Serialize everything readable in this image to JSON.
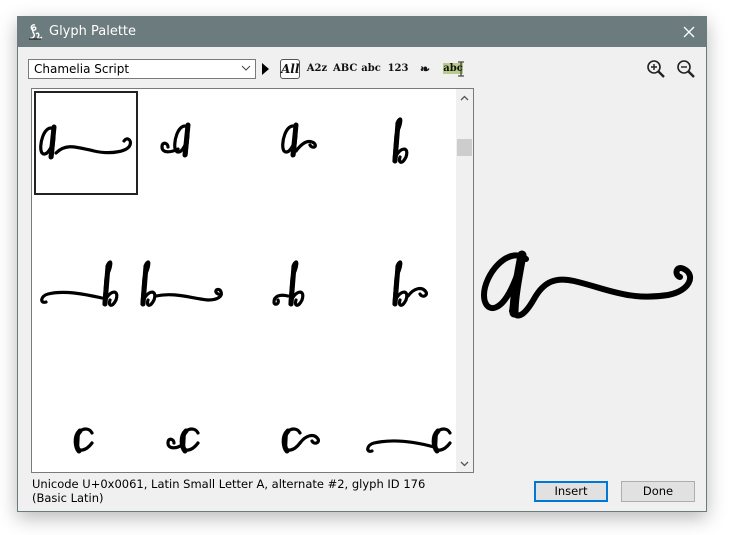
{
  "window": {
    "title": "Glyph Palette",
    "icon": "script-glyph-icon",
    "close_icon": "close-icon"
  },
  "toolbar": {
    "font_select": {
      "value": "Chamelia Script",
      "icon": "chevron-down-icon"
    },
    "play_icon": "triangle-right-icon",
    "filters": [
      {
        "label": "All",
        "selected": true
      },
      {
        "label": "A2z",
        "selected": false
      },
      {
        "label": "ABC",
        "selected": false
      },
      {
        "label": "abc",
        "selected": false
      },
      {
        "label": "123",
        "selected": false
      },
      {
        "label": "❧",
        "icon": "ornaments-icon",
        "selected": false
      },
      {
        "label": "abc",
        "icon": "highlight-text-icon",
        "selected": false
      }
    ],
    "zoom_in_icon": "zoom-in-icon",
    "zoom_out_icon": "zoom-out-icon"
  },
  "glyph_grid": {
    "rows": [
      [
        "a (swash right, selected)",
        "a (swash left)",
        "a (curl right)",
        "b"
      ],
      [
        "b (swash left)",
        "b (swash right)",
        "b (curl left)",
        "b (curl right)"
      ],
      [
        "c",
        "c (curl left)",
        "c (curl right)",
        "c (swash left)"
      ]
    ],
    "selected_index": 0
  },
  "preview": {
    "glyph": "a (alternate #2)"
  },
  "status": {
    "line1": "Unicode U+0x0061, Latin Small Letter A, alternate #2, glyph ID 176",
    "line2": "(Basic Latin)"
  },
  "buttons": {
    "insert": "Insert",
    "done": "Done"
  },
  "colors": {
    "titlebar": "#6b7b7e",
    "dialog_bg": "#f0f0f0",
    "default_button_border": "#0078d7",
    "highlight": "#b8cc8a"
  }
}
